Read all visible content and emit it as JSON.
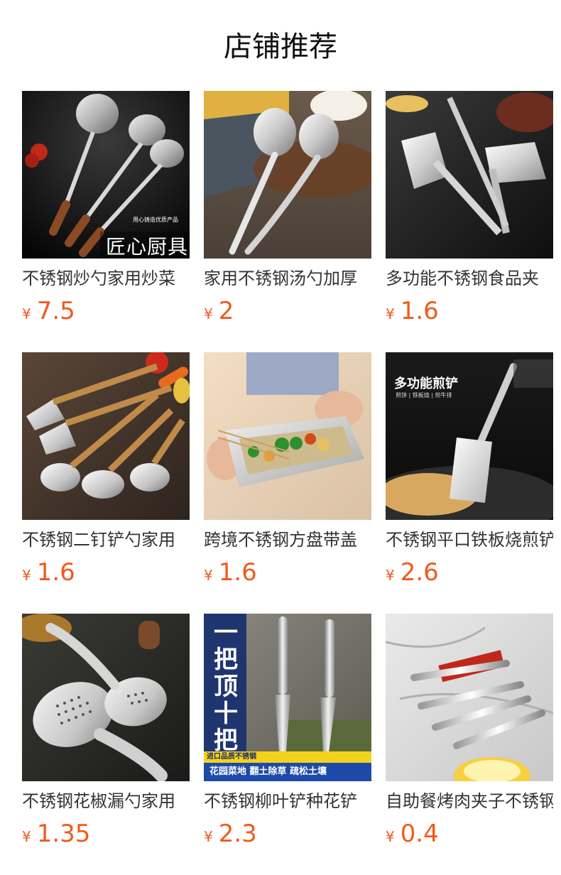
{
  "header": {
    "title": "店铺推荐"
  },
  "currency": "¥",
  "products": [
    {
      "name": "不锈钢炒勺家用炒菜",
      "price": "7.5",
      "thumb": "ladles-dark",
      "overlay": "匠心厨具",
      "overlay_small": "用心铸造优质产品"
    },
    {
      "name": "家用不锈钢汤勺加厚",
      "price": "2",
      "thumb": "soup-ladles"
    },
    {
      "name": "多功能不锈钢食品夹",
      "price": "1.6",
      "thumb": "food-tongs"
    },
    {
      "name": "不锈钢二钉铲勺家用",
      "price": "1.6",
      "thumb": "utensil-set"
    },
    {
      "name": "跨境不锈钢方盘带盖",
      "price": "1.6",
      "thumb": "square-tray"
    },
    {
      "name": "不锈钢平口铁板烧煎铲",
      "price": "2.6",
      "thumb": "griddle-spatula",
      "overlay": "多功能煎铲",
      "overlay_small": "煎饼 | 铁板烧 | 煎牛排"
    },
    {
      "name": "不锈钢花椒漏勺家用",
      "price": "1.35",
      "thumb": "slotted-spoon"
    },
    {
      "name": "不锈钢柳叶铲种花铲",
      "price": "2.3",
      "thumb": "garden-trowel",
      "overlay": "一把顶十把",
      "overlay_badge": "进口品质不锈钢",
      "overlay_banner": "花园菜地 翻土除草 疏松土壤"
    },
    {
      "name": "自助餐烤肉夹子不锈钢",
      "price": "0.4",
      "thumb": "bbq-tongs"
    }
  ],
  "colors": {
    "price": "#f05a1c",
    "title": "#111111"
  }
}
